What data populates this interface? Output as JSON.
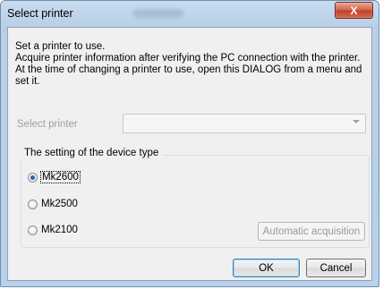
{
  "window": {
    "title": "Select printer",
    "close_glyph": "X"
  },
  "description": {
    "lines": [
      "Set a printer to use.",
      "Acquire printer information after verifying the PC connection with the printer.",
      "At the time of changing a printer to use, open this DIALOG from a menu and",
      "set it."
    ]
  },
  "printer_select": {
    "label": "Select printer",
    "value": ""
  },
  "device_type": {
    "title": "The setting of the device type",
    "options": [
      {
        "label": "Mk2600",
        "checked": true
      },
      {
        "label": "Mk2500",
        "checked": false
      },
      {
        "label": "Mk2100",
        "checked": false
      }
    ],
    "acquire_label": "Automatic acquisition"
  },
  "footer": {
    "ok_label": "OK",
    "cancel_label": "Cancel"
  },
  "icons": {
    "close": "close-icon",
    "dropdown": "chevron-down-icon",
    "radio": "radio-icon"
  }
}
